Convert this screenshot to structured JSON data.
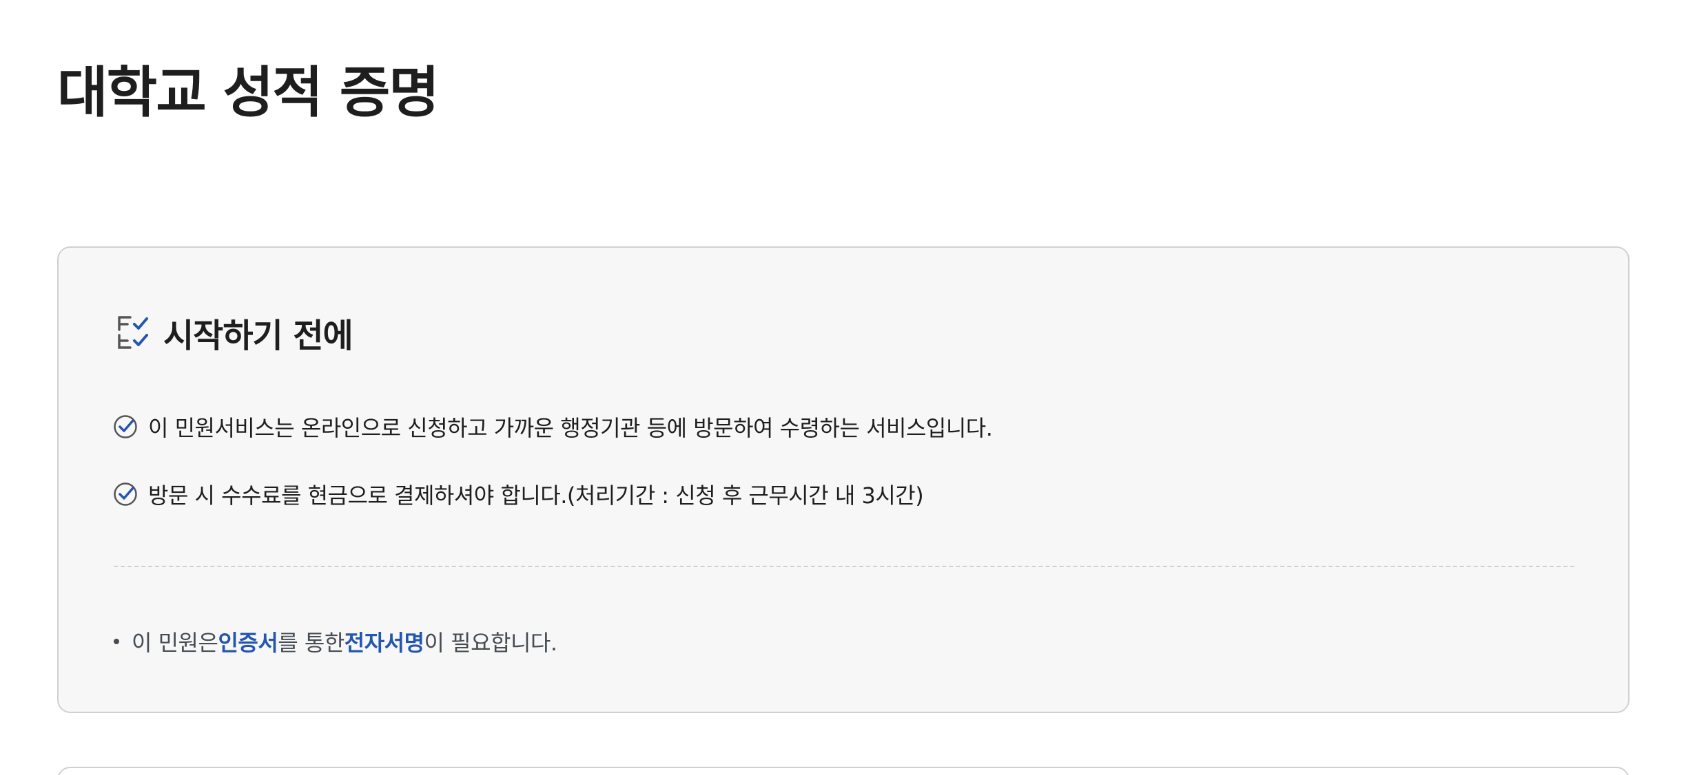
{
  "page": {
    "title": "대학교 성적 증명"
  },
  "before_start": {
    "icon": "checklist-icon",
    "title": "시작하기 전에",
    "items": [
      {
        "icon": "check-circle-icon",
        "text": "이 민원서비스는 온라인으로 신청하고 가까운 행정기관 등에 방문하여 수령하는 서비스입니다."
      },
      {
        "icon": "check-circle-icon",
        "text": "방문 시 수수료를 현금으로 결제하셔야 합니다.(처리기간 : 신청 후 근무시간 내 3시간)"
      }
    ],
    "note": {
      "part1": "이 민원은 ",
      "emph1": "인증서",
      "part2": "를 통한 ",
      "emph2": "전자서명",
      "part3": "이 필요합니다."
    }
  },
  "colors": {
    "accent_blue": "#2456b0",
    "card_bg": "#f7f7f7",
    "border": "#cdd1d5",
    "text": "#1e1e1e"
  }
}
